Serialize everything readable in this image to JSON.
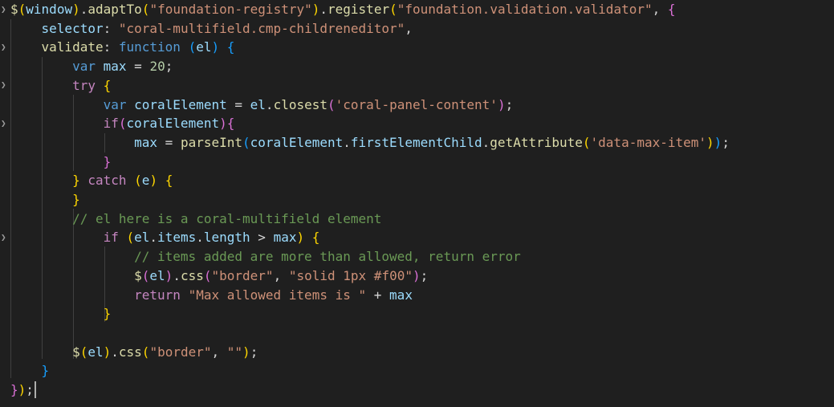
{
  "colors": {
    "background": "#1f1f1f",
    "function": "#dcdcaa",
    "variable": "#9cdcfe",
    "string": "#ce9178",
    "keyword": "#569cd6",
    "control": "#c586c0",
    "number": "#b5cea8",
    "comment": "#6a9955",
    "bracket_level1": "#ffd700",
    "bracket_level2": "#da70d6",
    "bracket_level3": "#179fff"
  },
  "icons": [
    "fold-chevron-icon"
  ],
  "code": {
    "l1": {
      "dollar": "$",
      "p1": "(",
      "window": "window",
      "p2": ")",
      "dot1": ".",
      "adaptTo": "adaptTo",
      "p3": "(",
      "s1": "\"foundation-registry\"",
      "p4": ")",
      "dot2": ".",
      "register": "register",
      "p5": "(",
      "s2": "\"foundation.validation.validator\"",
      "comma": ",",
      "brace": "{"
    },
    "l2": {
      "key": "selector",
      "colon": ":",
      "val": "\"coral-multifield.cmp-childreneditor\"",
      "comma": ","
    },
    "l3": {
      "key": "validate",
      "colon": ":",
      "fn": "function",
      "p1": "(",
      "param": "el",
      "p2": ")",
      "brace": "{"
    },
    "l4": {
      "kw": "var",
      "name": "max",
      "eq": "=",
      "num": "20",
      "semi": ";"
    },
    "l5": {
      "kw": "try",
      "brace": "{"
    },
    "l6": {
      "kw": "var",
      "name": "coralElement",
      "eq": "=",
      "obj": "el",
      "dot": ".",
      "method": "closest",
      "p1": "(",
      "str": "'coral-panel-content'",
      "p2": ")",
      "semi": ";"
    },
    "l7": {
      "kw": "if",
      "p1": "(",
      "name": "coralElement",
      "p2": ")",
      "brace": "{"
    },
    "l8": {
      "name": "max",
      "eq": "=",
      "fn": "parseInt",
      "p1": "(",
      "obj": "coralElement",
      "dot1": ".",
      "prop": "firstElementChild",
      "dot2": ".",
      "method": "getAttribute",
      "p2": "(",
      "str": "'data-max-item'",
      "p3": ")",
      "p4": ")",
      "semi": ";"
    },
    "l9": {
      "brace": "}"
    },
    "l10": {
      "brace1": "}",
      "kw": "catch",
      "p1": "(",
      "param": "e",
      "p2": ")",
      "brace2": "{"
    },
    "l11": {
      "brace": "}"
    },
    "l12": {
      "comment": "// el here is a coral-multifield element"
    },
    "l13": {
      "kw": "if",
      "p1": "(",
      "obj": "el",
      "dot1": ".",
      "prop1": "items",
      "dot2": ".",
      "prop2": "length",
      "op": ">",
      "name": "max",
      "p2": ")",
      "brace": "{"
    },
    "l14": {
      "comment": "// items added are more than allowed, return error"
    },
    "l15": {
      "dollar": "$",
      "p1": "(",
      "obj": "el",
      "p2": ")",
      "dot": ".",
      "method": "css",
      "p3": "(",
      "s1": "\"border\"",
      "comma": ",",
      "s2": "\"solid 1px #f00\"",
      "p4": ")",
      "semi": ";"
    },
    "l16": {
      "kw": "return",
      "str": "\"Max allowed items is \"",
      "op": "+",
      "name": "max"
    },
    "l17": {
      "brace": "}"
    },
    "l19": {
      "dollar": "$",
      "p1": "(",
      "obj": "el",
      "p2": ")",
      "dot": ".",
      "method": "css",
      "p3": "(",
      "s1": "\"border\"",
      "comma": ",",
      "s2": "\"\"",
      "p4": ")",
      "semi": ";"
    },
    "l20": {
      "brace": "}"
    },
    "l21": {
      "brace": "}",
      "p": ")",
      "p2": ")",
      "semi": ";"
    }
  }
}
